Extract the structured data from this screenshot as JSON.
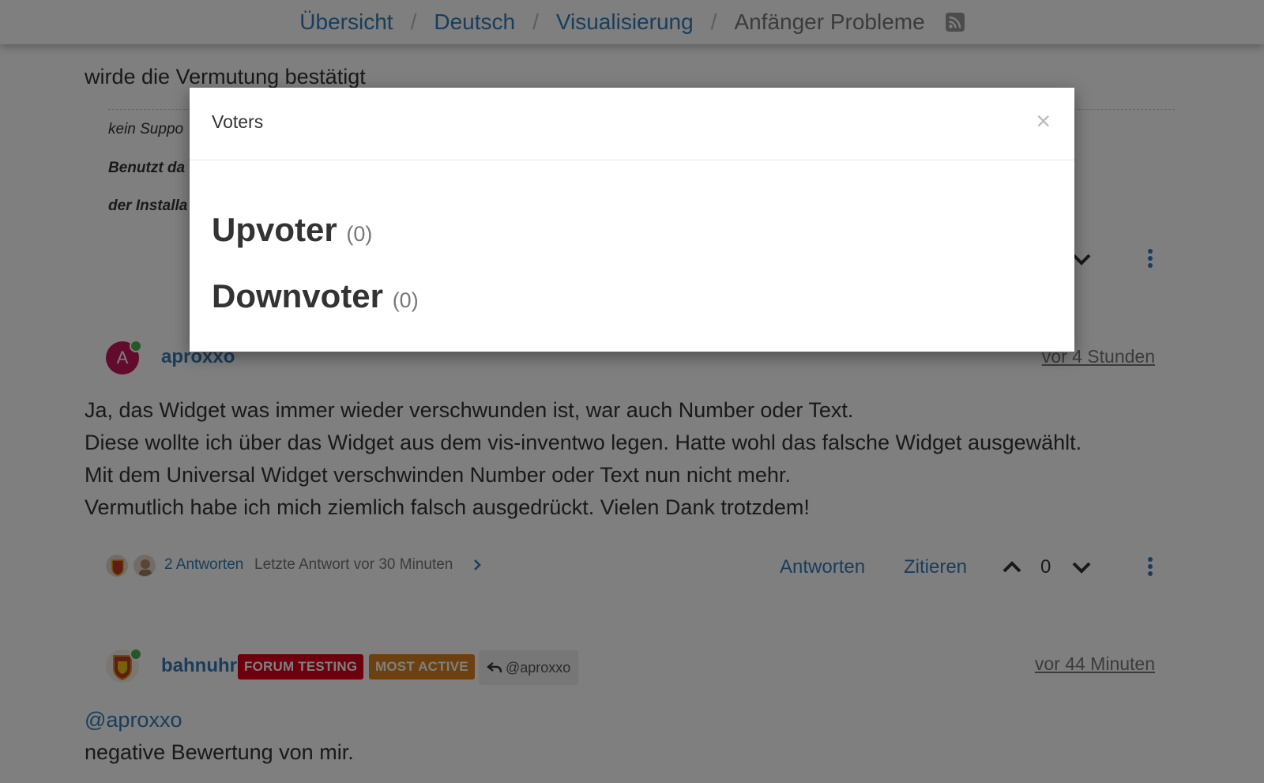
{
  "breadcrumb": {
    "items": [
      {
        "label": "Übersicht"
      },
      {
        "label": "Deutsch"
      },
      {
        "label": "Visualisierung"
      }
    ],
    "current": "Anfänger Probleme",
    "separator": "/"
  },
  "prev_post": {
    "text": "wirde die Vermutung bestätigt",
    "signature": {
      "line1": "kein Suppo",
      "line2": "Benutzt da",
      "line3": "der Installa"
    }
  },
  "post1": {
    "avatar_letter": "A",
    "avatar_color": "#c2185b",
    "username": "aproxxo",
    "timestamp": "vor 4 Stunden",
    "lines": [
      "Ja, das Widget was immer wieder verschwunden ist, war auch Number oder Text.",
      "Diese wollte ich über das Widget aus dem vis-inventwo legen. Hatte wohl das falsche Widget ausgewählt.",
      "Mit dem Universal Widget verschwinden Number oder Text nun nicht mehr.",
      "Vermutlich habe ich mich ziemlich falsch ausgedrückt. Vielen Dank trotzdem!"
    ],
    "replies_link": "2 Antworten",
    "replies_meta": "Letzte Antwort vor 30 Minuten",
    "reply_label": "Antworten",
    "quote_label": "Zitieren",
    "votes": "0"
  },
  "post2": {
    "username": "bahnuhr",
    "badges": [
      {
        "label": "FORUM TESTING",
        "color": "#d9001b"
      },
      {
        "label": "MOST ACTIVE",
        "color": "#d9831f"
      }
    ],
    "reply_to": "@aproxxo",
    "timestamp": "vor 44 Minuten",
    "mention": "@aproxxo",
    "text": "negative Bewertung von mir."
  },
  "modal": {
    "title": "Voters",
    "close": "×",
    "upvoter_label": "Upvoter",
    "upvoter_count": "(0)",
    "downvoter_label": "Downvoter",
    "downvoter_count": "(0)"
  },
  "colors": {
    "link": "#337ab7",
    "online": "#4caf50"
  }
}
